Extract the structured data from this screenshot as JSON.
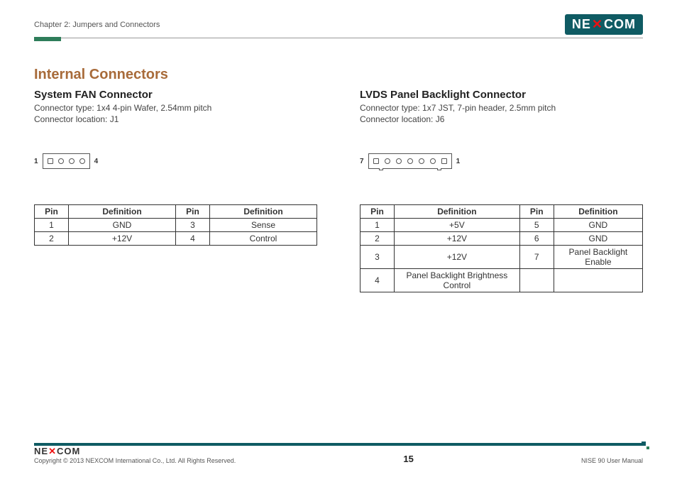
{
  "header": {
    "chapter": "Chapter 2: Jumpers and Connectors",
    "brand_left": "NE",
    "brand_right": "COM"
  },
  "main_title": "Internal Connectors",
  "left": {
    "title": "System FAN Connector",
    "line1": "Connector type: 1x4 4-pin Wafer, 2.54mm pitch",
    "line2": "Connector location: J1",
    "label_left": "1",
    "label_right": "4",
    "th_pin": "Pin",
    "th_def": "Definition",
    "rows": [
      {
        "p1": "1",
        "d1": "GND",
        "p2": "3",
        "d2": "Sense"
      },
      {
        "p1": "2",
        "d1": "+12V",
        "p2": "4",
        "d2": "Control"
      }
    ]
  },
  "right": {
    "title": "LVDS Panel Backlight Connector",
    "line1": "Connector type: 1x7 JST, 7-pin header, 2.5mm pitch",
    "line2": "Connector location: J6",
    "label_left": "7",
    "label_right": "1",
    "th_pin": "Pin",
    "th_def": "Definition",
    "rows": [
      {
        "p1": "1",
        "d1": "+5V",
        "p2": "5",
        "d2": "GND"
      },
      {
        "p1": "2",
        "d1": "+12V",
        "p2": "6",
        "d2": "GND"
      },
      {
        "p1": "3",
        "d1": "+12V",
        "p2": "7",
        "d2": "Panel Backlight Enable"
      },
      {
        "p1": "4",
        "d1": "Panel Backlight Brightness Control",
        "p2": "",
        "d2": ""
      }
    ]
  },
  "footer": {
    "brand_left": "NE",
    "brand_right": "COM",
    "copyright": "Copyright © 2013 NEXCOM International Co., Ltd. All Rights Reserved.",
    "page": "15",
    "doc": "NISE 90 User Manual"
  }
}
